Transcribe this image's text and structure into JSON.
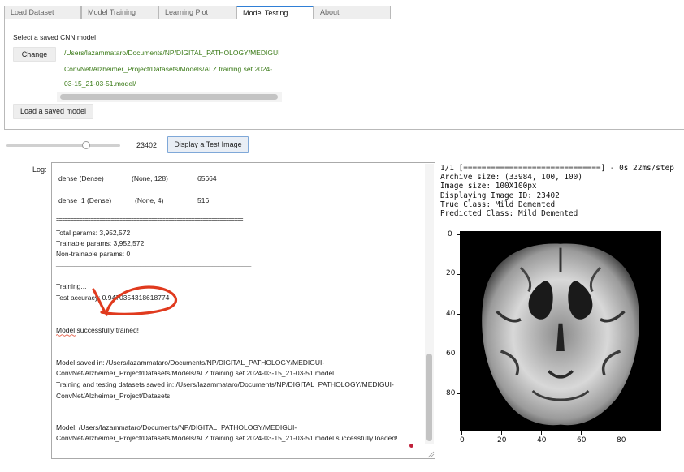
{
  "tabs": [
    "Load Dataset",
    "Model Training",
    "Learning Plot",
    "Model Testing",
    "About"
  ],
  "active_tab": "Model Testing",
  "model_select": {
    "label": "Select a saved CNN model",
    "change_button": "Change",
    "path_lines": [
      "/Users/lazammataro/Documents/NP/DIGITAL_PATHOLOGY/MEDIGUI",
      "ConvNet/Alzheimer_Project/Datasets/Models/ALZ.training.set.2024-",
      "03-15_21-03-51.model/"
    ],
    "load_button": "Load a saved model"
  },
  "slider": {
    "value": "23402",
    "fill_fraction": 0.7
  },
  "display_button": "Display a Test Image",
  "log": {
    "label": "Log:",
    "rows": [
      {
        "name": "dense (Dense)",
        "shape": "(None, 128)",
        "params": "65664"
      },
      {
        "name": "dense_1 (Dense)",
        "shape": "(None, 4)",
        "params": "516"
      }
    ],
    "separator": "=================================================================",
    "total_params": "Total params: 3,952,572",
    "trainable_params": "Trainable params: 3,952,572",
    "non_trainable_params": "Non-trainable params: 0",
    "rule": "_________________________________________________________________",
    "training": "Training...",
    "test_accuracy": "Test accuracy: 0.9470354318618774",
    "trained_message": "Model successfully trained!",
    "saved_line_1": "Model saved in: /Users/lazammataro/Documents/NP/DIGITAL_PATHOLOGY/MEDIGUI-",
    "saved_line_2": "ConvNet/Alzheimer_Project/Datasets/Models/ALZ.training.set.2024-03-15_21-03-51.model",
    "datasets_line_1": "Training and testing datasets saved in: /Users/lazammataro/Documents/NP/DIGITAL_PATHOLOGY/MEDIGUI-",
    "datasets_line_2": "ConvNet/Alzheimer_Project/Datasets",
    "loaded_line_1": "Model: /Users/lazammataro/Documents/NP/DIGITAL_PATHOLOGY/MEDIGUI-",
    "loaded_line_2": "ConvNet/Alzheimer_Project/Datasets/Models/ALZ.training.set.2024-03-15_21-03-51.model successfully loaded!"
  },
  "output": {
    "progress": "1/1 [==============================] - 0s 22ms/step",
    "archive_size": "Archive size: (33984, 100, 100)",
    "image_size": "Image size: 100X100px",
    "image_id": "Displaying Image ID: 23402",
    "true_class": "True Class: Mild Demented",
    "predicted_class": "Predicted Class: Mild Demented"
  },
  "plot": {
    "y_ticks": [
      "0",
      "20",
      "40",
      "60",
      "80"
    ],
    "x_ticks": [
      "0",
      "20",
      "40",
      "60",
      "80"
    ]
  },
  "colors": {
    "accent": "#2f7fd6",
    "path_green": "#3a7a17",
    "annotation": "#e03a1e"
  }
}
